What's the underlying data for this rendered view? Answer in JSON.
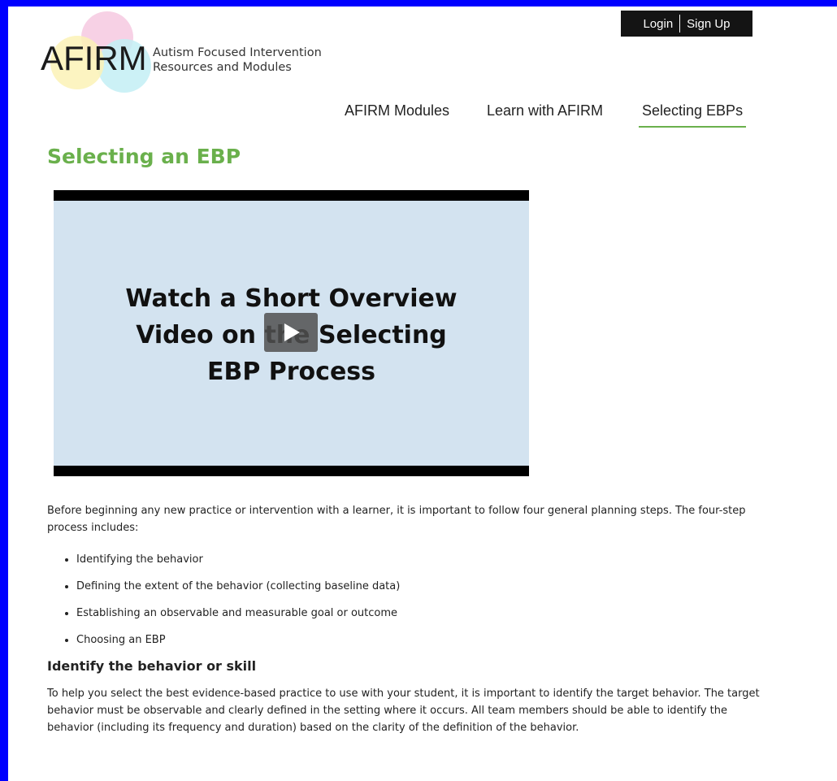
{
  "header": {
    "logo_text": "AFIRM",
    "tagline": "Autism Focused Intervention Resources and Modules",
    "login": "Login",
    "signup": "Sign Up"
  },
  "nav": {
    "items": [
      "AFIRM Modules",
      "Learn with AFIRM",
      "Selecting EBPs"
    ],
    "active": "Selecting EBPs"
  },
  "page_title": "Selecting an EBP",
  "video": {
    "thumbnail_text": "Watch a Short Overview\nVideo on the Selecting\nEBP Process"
  },
  "content": {
    "intro": "Before beginning any new practice or intervention with a learner, it is important to follow four general planning steps. The four-step process includes:",
    "steps": [
      "Identifying the behavior",
      "Defining the extent of the behavior (collecting baseline data)",
      "Establishing an observable and measurable goal or outcome",
      "Choosing an EBP"
    ],
    "section_heading": "Identify the behavior or skill",
    "section_text": "To help you select the best evidence-based practice to use with your student, it is important to identify the target behavior. The target behavior must be observable and clearly defined in the setting where it occurs. All team members should be able to identify the behavior (including its frequency and duration) based on the clarity of the definition of the behavior."
  },
  "colors": {
    "accent": "#6ab04c",
    "frame": "#0000ff",
    "video_bg": "#d3e3f0"
  }
}
